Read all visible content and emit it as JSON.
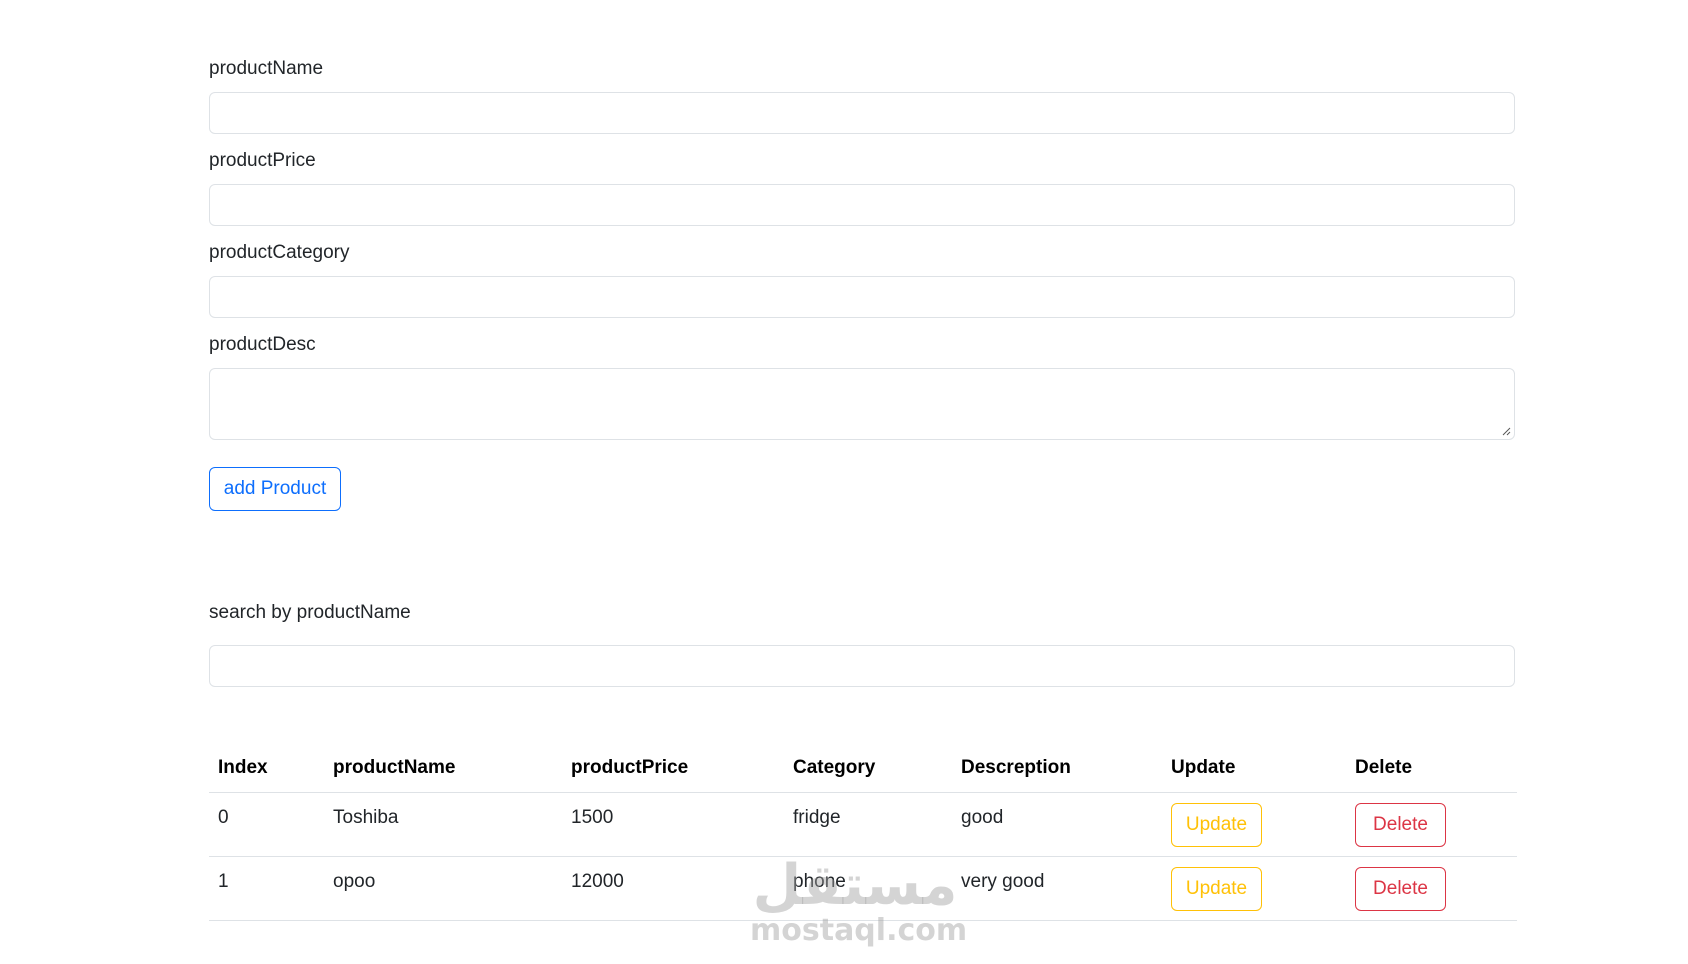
{
  "form": {
    "name_label": "productName",
    "price_label": "productPrice",
    "category_label": "productCategory",
    "desc_label": "productDesc",
    "name_value": "",
    "price_value": "",
    "category_value": "",
    "desc_value": "",
    "add_button_label": "add Product"
  },
  "search": {
    "label": "search by productName",
    "value": ""
  },
  "table": {
    "headers": [
      "Index",
      "productName",
      "productPrice",
      "Category",
      "Descreption",
      "Update",
      "Delete"
    ],
    "rows": [
      {
        "index": "0",
        "name": "Toshiba",
        "price": "1500",
        "category": "fridge",
        "desc": "good",
        "update_label": "Update",
        "delete_label": "Delete"
      },
      {
        "index": "1",
        "name": "opoo",
        "price": "12000",
        "category": "phone",
        "desc": "very good",
        "update_label": "Update",
        "delete_label": "Delete"
      }
    ]
  },
  "watermark": {
    "arabic": "مستقل",
    "latin": "mostaql.com"
  },
  "colors": {
    "primary": "#0d6efd",
    "warning": "#ffc107",
    "danger": "#dc3545",
    "border": "#dee2e6"
  }
}
